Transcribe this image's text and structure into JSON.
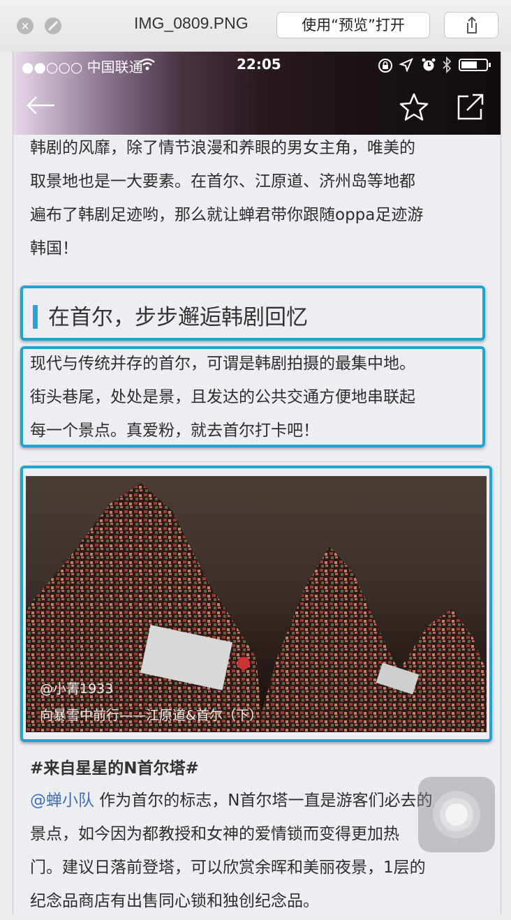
{
  "window": {
    "title": "IMG_0809.PNG",
    "open_button": "使用“预览”打开"
  },
  "status_bar": {
    "carrier": "●●○○○ 中国联通",
    "time": "22:05"
  },
  "intro": {
    "lines": [
      "韩剧的风靡，除了情节浪漫和养眼的男女主角，唯美的",
      "取景地也是一大要素。在首尔、江原道、济州岛等地都",
      "遍布了韩剧足迹哟，那么就让蝉君带你跟随oppa足迹游",
      "韩国！"
    ]
  },
  "section": {
    "title": "在首尔，步步邂逅韩剧回忆",
    "lines": [
      "现代与传统并存的首尔，可谓是韩剧拍摄的最集中地。",
      "街头巷尾，处处是景，且发达的公共交通方便地串联起",
      "每一个景点。真爱粉，就去首尔打卡吧！"
    ]
  },
  "photo": {
    "credit": "@小菁1933",
    "caption": "向暴雪中前行——江原道&首尔（下）"
  },
  "post": {
    "topic": "#来自星星的N首尔塔#",
    "mention": "@蝉小队",
    "first_line": " 作为首尔的标志，N首尔塔一直是游客们必去的",
    "lines": [
      "景点，如今因为都教授和女神的爱情锁而变得更加热",
      "门。建议日落前登塔，可以欣赏余晖和美丽夜景，1层的",
      "纪念品商店有出售同心锁和独创纪念品。"
    ]
  },
  "colors": {
    "highlight": "#1ea3d3",
    "section_bar": "#2aa1dd",
    "mention": "#3f6fb5"
  },
  "icons": [
    "close-icon",
    "minimize-icon",
    "share-icon",
    "wifi-icon",
    "lock-rotation-icon",
    "location-icon",
    "alarm-icon",
    "bluetooth-icon",
    "battery-icon",
    "back-arrow-icon",
    "star-icon",
    "external-share-icon",
    "assistive-touch-icon"
  ]
}
